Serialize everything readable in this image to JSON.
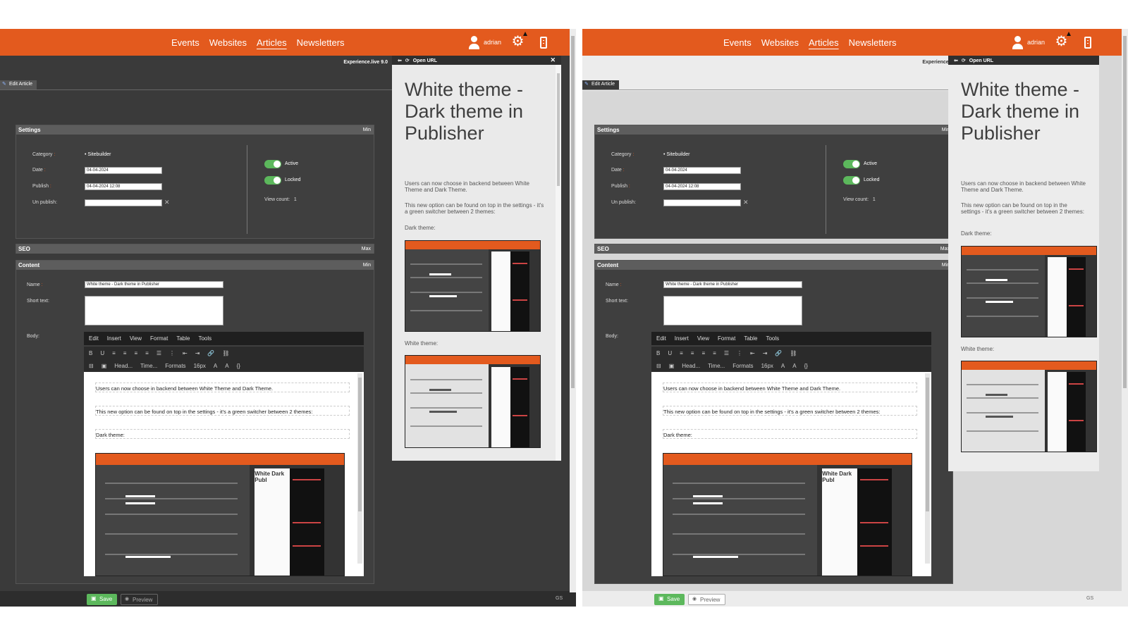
{
  "nav": {
    "items": [
      "Events",
      "Websites",
      "Articles",
      "Newsletters"
    ],
    "active": "Articles"
  },
  "user": {
    "name": "adrian"
  },
  "version": "Experience.live 9.0",
  "tab_label": "Edit Article",
  "settings": {
    "title": "Settings",
    "toggle_label": "Min",
    "category_label": "Category",
    "category_value": "• Sitebuilder",
    "date_label": "Date",
    "date_value": "04-04-2024",
    "publish_label": "Publish",
    "publish_value": "04-04-2024 12:08",
    "unpublish_label": "Un publish",
    "unpublish_value": "",
    "active_label": "Active",
    "locked_label": "Locked",
    "viewcount_label": "View count:",
    "viewcount_value": "1"
  },
  "seo": {
    "title": "SEO",
    "toggle_label": "Max"
  },
  "content": {
    "title": "Content",
    "toggle_label": "Min",
    "name_label": "Name",
    "name_value": "White theme - Dark theme in Publisher",
    "short_label": "Short text:",
    "body_label": "Body:"
  },
  "editor": {
    "menus": [
      "Edit",
      "Insert",
      "View",
      "Format",
      "Table",
      "Tools"
    ],
    "toolbar_row1": [
      "B",
      "U",
      "≡",
      "≡",
      "≡",
      "≡",
      "☰",
      "⋮",
      "⇤",
      "⇥",
      "🔗",
      "⛓"
    ],
    "toolbar_row2": [
      "⊟",
      "▣",
      "Head...",
      "Time...",
      "Formats",
      "16px",
      "A",
      "A",
      "{}"
    ],
    "paragraphs": [
      "Users can now choose in backend between White Theme and Dark Theme.",
      "This new option can be found on top in the settings - it's a green switcher between 2 themes:",
      "Dark theme:"
    ]
  },
  "preview": {
    "header": "Open URL",
    "title": "White theme - Dark theme in Publisher",
    "p1": "Users can now choose in backend between White Theme and Dark Theme.",
    "p2": "This new option can be found on top in the settings - it's a green switcher between 2 themes:",
    "dark_label": "Dark theme:",
    "white_label": "White theme:"
  },
  "mini_title": "White Dark Publ",
  "buttons": {
    "save": "Save",
    "preview": "Preview"
  },
  "edge_text": "GS",
  "colors": {
    "accent": "#e35a1e",
    "toggle": "#5cb85c",
    "dark_bg": "#3a3a3a",
    "light_bg": "#d7d7d7"
  }
}
